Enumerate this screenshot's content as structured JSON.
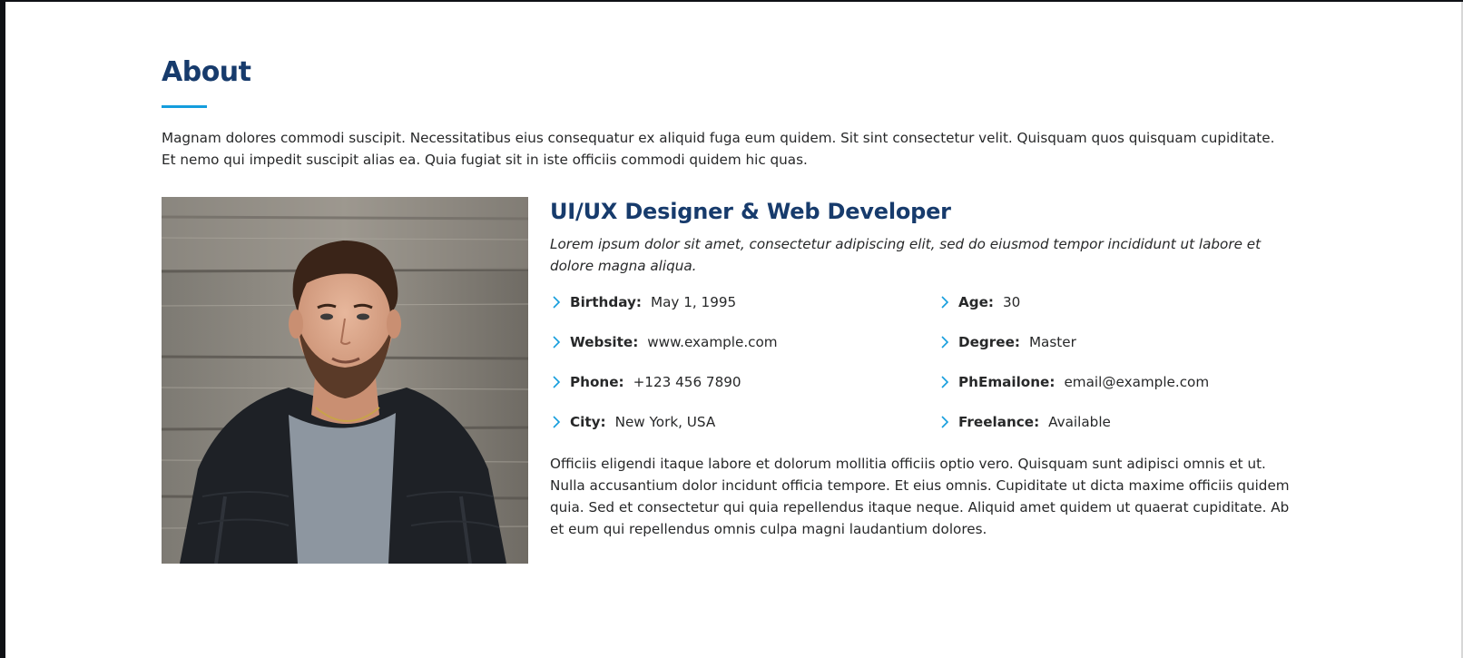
{
  "about": {
    "title": "About",
    "intro": "Magnam dolores commodi suscipit. Necessitatibus eius consequatur ex aliquid fuga eum quidem. Sit sint consectetur velit. Quisquam quos quisquam cupiditate. Et nemo qui impedit suscipit alias ea. Quia fugiat sit in iste officiis commodi quidem hic quas.",
    "role_title": "UI/UX Designer & Web Developer",
    "role_lede": "Lorem ipsum dolor sit amet, consectetur adipiscing elit, sed do eiusmod tempor incididunt ut labore et dolore magna aliqua.",
    "facts": [
      {
        "label": "Birthday:",
        "value": "May 1, 1995"
      },
      {
        "label": "Age:",
        "value": "30"
      },
      {
        "label": "Website:",
        "value": "www.example.com"
      },
      {
        "label": "Degree:",
        "value": "Master"
      },
      {
        "label": "Phone:",
        "value": "+123 456 7890"
      },
      {
        "label": "PhEmailone:",
        "value": "email@example.com"
      },
      {
        "label": "City:",
        "value": "New York, USA"
      },
      {
        "label": "Freelance:",
        "value": "Available"
      }
    ],
    "closing": "Officiis eligendi itaque labore et dolorum mollitia officiis optio vero. Quisquam sunt adipisci omnis et ut. Nulla accusantium dolor incidunt officia tempore. Et eius omnis. Cupiditate ut dicta maxime officiis quidem quia. Sed et consectetur qui quia repellendus itaque neque. Aliquid amet quidem ut quaerat cupiditate. Ab et eum qui repellendus omnis culpa magni laudantium dolores."
  },
  "theme": {
    "heading_color": "#173b6c",
    "accent_color": "#149ddd",
    "text_color": "#272829"
  },
  "icons": {
    "fact_bullet": "chevron-right-icon"
  }
}
